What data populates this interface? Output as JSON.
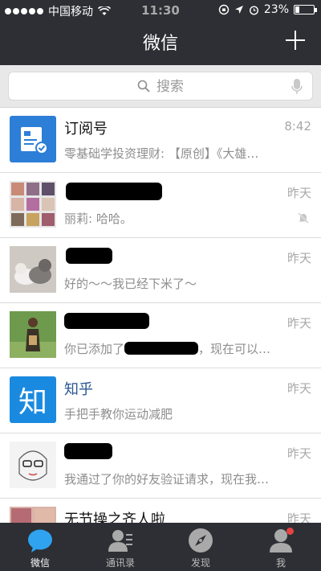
{
  "status_bar": {
    "carrier": "中国移动",
    "time": "11:30",
    "battery_percent": "23%",
    "battery_level": 0.23
  },
  "header": {
    "title": "微信"
  },
  "search": {
    "placeholder": "搜索"
  },
  "chats": [
    {
      "name": "订阅号",
      "time": "8:42",
      "preview": "零基础学投资理财: 【原创】《大雄…"
    },
    {
      "name": "",
      "time": "昨天",
      "preview": "丽莉: 哈哈。",
      "muted": true
    },
    {
      "name": "",
      "time": "昨天",
      "preview": "好的～～我已经下米了～"
    },
    {
      "name": "",
      "time": "昨天",
      "preview_start": "你已添加了",
      "preview_end": "，现在可以…"
    },
    {
      "name": "知乎",
      "time": "昨天",
      "preview": "手把手教你运动减肥"
    },
    {
      "name": "",
      "time": "昨天",
      "preview": "我通过了你的好友验证请求，现在我…"
    },
    {
      "name": "无节操之齐人啦",
      "time": "昨天",
      "preview": ""
    }
  ],
  "tabs": [
    {
      "label": "微信",
      "icon": "chat-bubble-icon",
      "active": true
    },
    {
      "label": "通讯录",
      "icon": "contacts-icon"
    },
    {
      "label": "发现",
      "icon": "compass-icon"
    },
    {
      "label": "我",
      "icon": "person-icon",
      "badge": true
    }
  ],
  "colors": {
    "bar_background": "#2d2f34",
    "active_tab": "#2fa3f0",
    "zhihu_blue": "#1a8ae0",
    "badge_red": "#e64340"
  },
  "avatar_texts": {
    "zhihu": "知"
  }
}
